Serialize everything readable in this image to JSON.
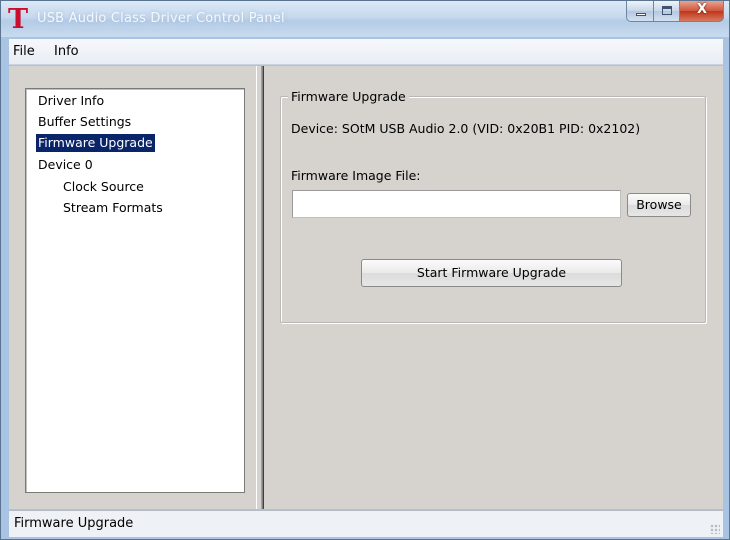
{
  "window": {
    "title": "USB Audio Class Driver Control Panel",
    "logo_glyph": "T",
    "close_glyph": "X",
    "colors": {
      "logo": "#c8102e",
      "selection": "#0a246a"
    }
  },
  "menubar": {
    "items": [
      {
        "label": "File"
      },
      {
        "label": "Info"
      }
    ]
  },
  "tree": {
    "items": [
      {
        "label": "Driver Info",
        "level": 0,
        "selected": false
      },
      {
        "label": "Buffer Settings",
        "level": 0,
        "selected": false
      },
      {
        "label": "Firmware Upgrade",
        "level": 0,
        "selected": true
      },
      {
        "label": "Device 0",
        "level": 0,
        "selected": false
      },
      {
        "label": "Clock Source",
        "level": 1,
        "selected": false
      },
      {
        "label": "Stream Formats",
        "level": 1,
        "selected": false
      }
    ]
  },
  "firmware": {
    "group_title": "Firmware Upgrade",
    "device_info": "Device: SOtM USB Audio 2.0 (VID: 0x20B1 PID: 0x2102)",
    "file_label": "Firmware Image File:",
    "file_value": "",
    "browse_label": "Browse",
    "start_label": "Start Firmware Upgrade"
  },
  "statusbar": {
    "text": "Firmware Upgrade"
  }
}
